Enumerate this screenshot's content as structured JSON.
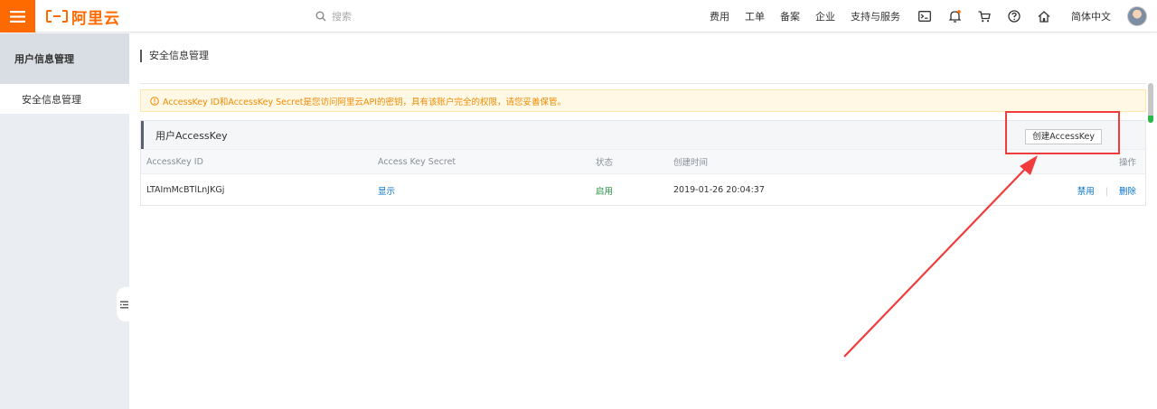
{
  "header": {
    "logo_text": "阿里云",
    "search_placeholder": "搜索",
    "nav_links": [
      "费用",
      "工单",
      "备案",
      "企业",
      "支持与服务"
    ],
    "language": "简体中文",
    "icons": [
      "terminal-icon",
      "bell-icon",
      "cart-icon",
      "help-icon",
      "home-icon"
    ]
  },
  "sidebar": {
    "section_title": "用户信息管理",
    "items": [
      {
        "label": "安全信息管理"
      }
    ]
  },
  "main": {
    "page_title": "安全信息管理",
    "notice": "AccessKey ID和AccessKey Secret是您访问阿里云API的密钥，具有该账户完全的权限，请您妥善保管。",
    "panel": {
      "title": "用户AccessKey",
      "create_button": "创建AccessKey",
      "columns": [
        "AccessKey ID",
        "Access Key Secret",
        "状态",
        "创建时间",
        "操作"
      ],
      "rows": [
        {
          "id": "LTAImMcBTlLnJKGj",
          "secret_action": "显示",
          "status": "启用",
          "created": "2019-01-26 20:04:37",
          "actions": [
            "禁用",
            "删除"
          ]
        }
      ]
    }
  },
  "colors": {
    "brand": "#ff6a00",
    "link": "#0070cc",
    "status_ok": "#1e8e3e",
    "notice_text": "#f08a00",
    "annotation": "#f03c3c"
  }
}
